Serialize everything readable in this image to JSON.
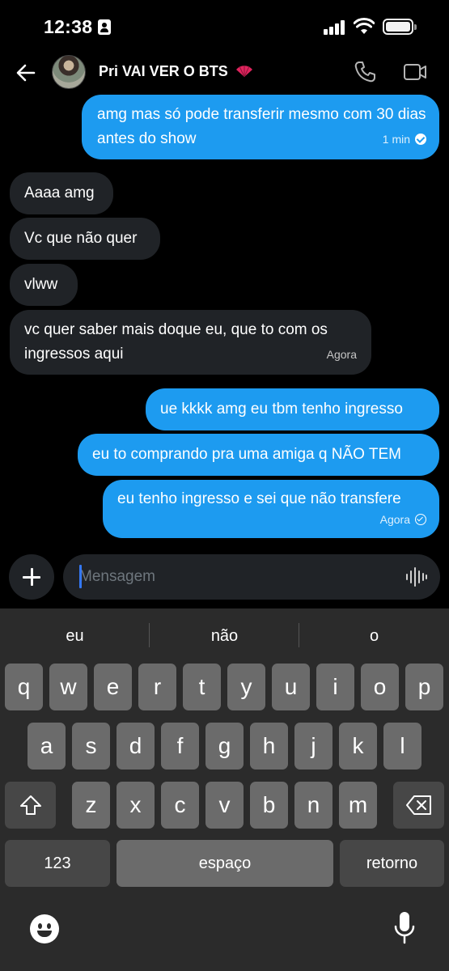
{
  "status_bar": {
    "time": "12:38"
  },
  "header": {
    "title": "Pri VAI VER O BTS",
    "title_emoji": "folding-fan-icon"
  },
  "messages": [
    {
      "dir": "out",
      "text": "amg mas só pode transferir mesmo com 30 dias antes do show",
      "time": "1 min",
      "status": "read"
    },
    {
      "dir": "in",
      "text": "Aaaa amg"
    },
    {
      "dir": "in",
      "text": "Vc que não quer"
    },
    {
      "dir": "in",
      "text": "vlww"
    },
    {
      "dir": "in",
      "text": "vc quer saber mais doque eu, que to com os ingressos aqui",
      "time": "Agora"
    },
    {
      "dir": "out",
      "text": "ue kkkk amg eu tbm tenho ingresso"
    },
    {
      "dir": "out",
      "text": "eu to comprando pra uma amiga q NÃO TEM"
    },
    {
      "dir": "out",
      "text": "eu tenho ingresso e sei que não transfere",
      "time": "Agora",
      "status": "sent"
    }
  ],
  "composer": {
    "placeholder": "Mensagem"
  },
  "keyboard": {
    "suggestions": [
      "eu",
      "não",
      "o"
    ],
    "row1": [
      "q",
      "w",
      "e",
      "r",
      "t",
      "y",
      "u",
      "i",
      "o",
      "p"
    ],
    "row2": [
      "a",
      "s",
      "d",
      "f",
      "g",
      "h",
      "j",
      "k",
      "l"
    ],
    "row3": [
      "z",
      "x",
      "c",
      "v",
      "b",
      "n",
      "m"
    ],
    "numbers": "123",
    "space": "espaço",
    "return": "retorno"
  },
  "colors": {
    "outgoing_bubble": "#1d9bf0",
    "incoming_bubble": "#202327",
    "background": "#000000"
  }
}
